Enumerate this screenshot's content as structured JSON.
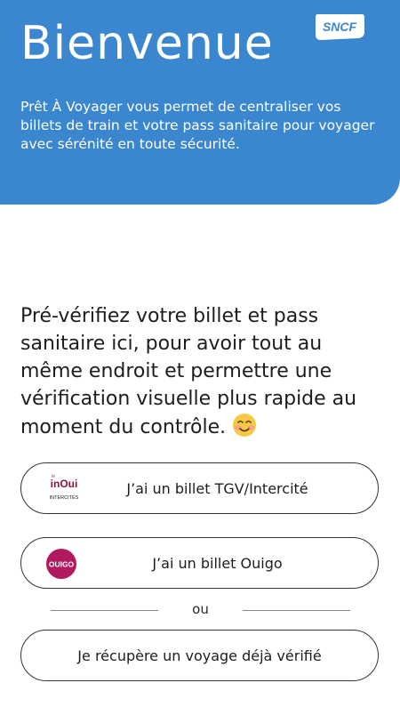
{
  "hero": {
    "title": "Bienvenue",
    "logo_text": "SNCF",
    "description": "Prêt À Voyager vous permet de centraliser vos billets de train et votre pass sanitaire pour voyager avec sérénité en toute sécurité.",
    "background_color": "#3a86cf"
  },
  "intro": {
    "text": "Pré-vérifiez votre billet et pass sanitaire ici, pour avoir tout au même endroit et permettre une vérification visuelle plus rapide au moment du contrôle.",
    "emoji_icon": "smiling-face-icon"
  },
  "choices": {
    "tgv": {
      "label": "J’ai un billet TGV/Intercité",
      "logo_top": "inOui",
      "logo_bottom": "INTERCITÉS"
    },
    "ouigo": {
      "label": "J’ai un billet Ouigo",
      "logo_text": "OUIGO",
      "logo_color": "#b2195f"
    },
    "retrieve": {
      "label": "Je récupère un voyage déjà vérifié"
    }
  },
  "divider": {
    "text": "ou"
  }
}
